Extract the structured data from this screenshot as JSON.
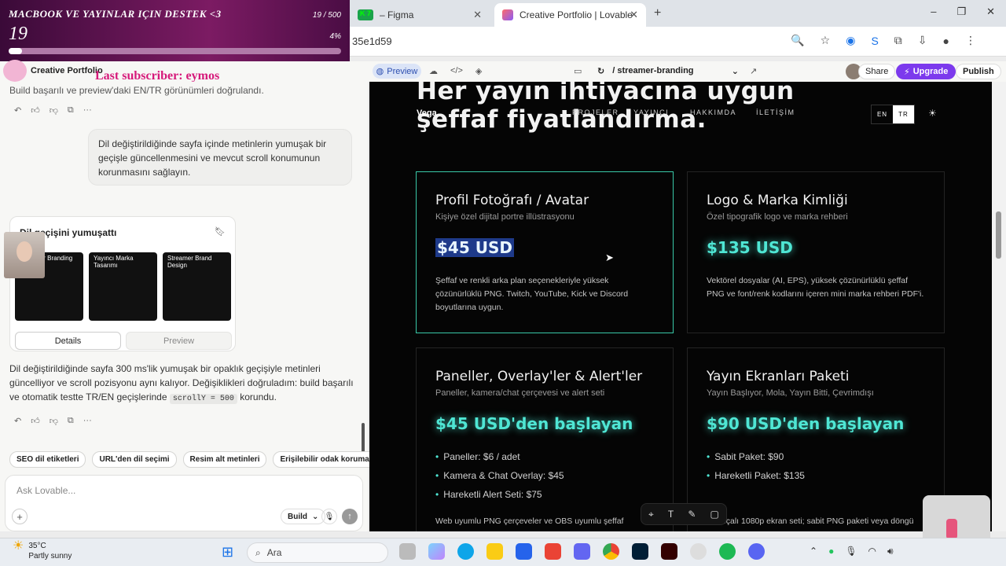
{
  "stream_goal": {
    "title": "MACBOOK VE YAYINLAR IÇIN DESTEK <3",
    "count": "19 / 500",
    "amount": "19",
    "percent": "4%",
    "progress_fraction": 0.04
  },
  "subscriber_overlay": "Last subscriber: eymos",
  "browser": {
    "tabs": [
      {
        "label": "– Figma",
        "badge": "K 7",
        "active": false
      },
      {
        "label": "Creative Portfolio | Lovable",
        "active": true
      }
    ],
    "url": "35e1d59",
    "new_tab": "+",
    "minimize": "–",
    "maximize": "❐",
    "close": "✕"
  },
  "app_toolbar": {
    "project_name": "Creative Portfolio",
    "preview_label": "Preview",
    "branch": "/ streamer-branding",
    "share_label": "Share",
    "upgrade_label": "Upgrade",
    "publish_label": "Publish"
  },
  "chat": {
    "top_text": "Build başarılı ve preview'daki EN/TR görünümleri doğrulandı.",
    "user_message": "Dil değiştirildiğinde sayfa içinde metinlerin yumuşak bir geçişle güncellenmesini ve mevcut scroll konumunun korunmasını sağlayın.",
    "card_title": "Dil geçişini yumuşattı",
    "thumbs": [
      {
        "text": "Streamer Branding Design"
      },
      {
        "text": "Yayıncı Marka Tasarımı"
      },
      {
        "text": "Streamer Brand Design"
      }
    ],
    "details_label": "Details",
    "preview_label": "Preview",
    "response_text_1": "Dil değiştirildiğinde sayfa 300 ms'lik yumuşak bir opaklık geçişiyle metinleri güncelliyor ve scroll pozisyonu aynı kalıyor. Değişiklikleri doğruladım: build başarılı ve otomatik testte TR/EN geçişlerinde",
    "response_code": "scrollY = 500",
    "response_text_2": "korundu.",
    "chips": [
      "SEO dil etiketleri",
      "URL'den dil seçimi",
      "Resim alt metinleri",
      "Erişilebilir odak koruma"
    ],
    "input_placeholder": "Ask Lovable...",
    "build_label": "Build"
  },
  "preview": {
    "hero_line1": "Her yayın ihtiyacına uygun",
    "hero_line2": "şeffaf fiyatlandırma.",
    "nav": {
      "brand": "Vega",
      "items": [
        "PROJELER",
        "YAYINCI",
        "HAKKIMDA",
        "İLETİŞİM"
      ]
    },
    "lang": {
      "en": "EN",
      "tr": "TR"
    },
    "cards": [
      {
        "title": "Profil Fotoğrafı / Avatar",
        "subtitle": "Kişiye özel dijital portre illüstrasyonu",
        "price": "$45 USD",
        "desc": "Şeffaf ve renkli arka plan seçenekleriyle yüksek çözünürlüklü PNG. Twitch, YouTube, Kick ve Discord boyutlarına uygun."
      },
      {
        "title": "Logo & Marka Kimliği",
        "subtitle": "Özel tipografik logo ve marka rehberi",
        "price": "$135 USD",
        "desc": "Vektörel dosyalar (AI, EPS), yüksek çözünürlüklü şeffaf PNG ve font/renk kodlarını içeren mini marka rehberi PDF'i."
      },
      {
        "title": "Paneller, Overlay'ler & Alert'ler",
        "subtitle": "Paneller, kamera/chat çerçevesi ve alert seti",
        "price": "$45 USD'den başlayan",
        "list": [
          "Paneller: $6 / adet",
          "Kamera & Chat Overlay: $45",
          "Hareketli Alert Seti: $75"
        ],
        "desc": "Web uyumlu PNG çerçeveler ve OBS uyumlu şeffaf"
      },
      {
        "title": "Yayın Ekranları Paketi",
        "subtitle": "Yayın Başlıyor, Mola, Yayın Bitti, Çevrimdışı",
        "price": "$90 USD'den başlayan",
        "list": [
          "Sabit Paket: $90",
          "Hareketli Paket: $135"
        ],
        "desc": "...çalı 1080p ekran seti; sabit PNG paketi veya döngü"
      }
    ]
  },
  "taskbar": {
    "temperature": "35°C",
    "condition": "Partly sunny",
    "search_label": "Ara"
  },
  "colors": {
    "accent_cyan": "#4fe6d4",
    "upgrade_purple": "#7c3aed",
    "selected_border": "#39c9a8",
    "overlay_pink": "#d6197a"
  }
}
